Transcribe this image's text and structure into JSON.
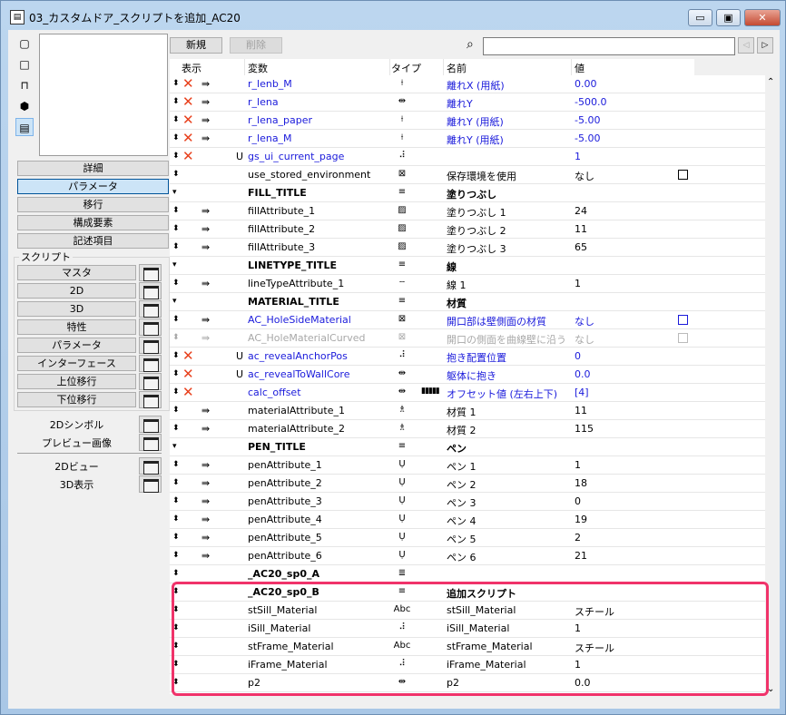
{
  "window": {
    "title": "03_カスタムドア_スクリプトを追加_AC20",
    "minimize": "▭",
    "restore": "▣",
    "close": "✕"
  },
  "left": {
    "panel_buttons": [
      {
        "label": "詳細"
      },
      {
        "label": "パラメータ",
        "selected": true
      },
      {
        "label": "移行"
      },
      {
        "label": "構成要素"
      },
      {
        "label": "記述項目"
      }
    ],
    "script_group_label": "スクリプト",
    "script_buttons": [
      "マスタ",
      "2D",
      "3D",
      "特性",
      "パラメータ",
      "インターフェース",
      "上位移行",
      "下位移行"
    ],
    "extra_items": [
      "2Dシンボル",
      "プレビュー画像"
    ],
    "view_items": [
      "2Dビュー",
      "3D表示"
    ]
  },
  "toolbar": {
    "new_label": "新規",
    "delete_label": "削除",
    "search_value": "",
    "prev": "◁",
    "next": "▷"
  },
  "columns": {
    "show": "表示",
    "variable": "変数",
    "type": "タイプ",
    "name": "名前",
    "value": "値"
  },
  "rows": [
    {
      "var": "r_lenb_M",
      "type": "⟊",
      "name": "離れX (用紙)",
      "value": "0.00",
      "x": true,
      "ind": true,
      "style": "blue"
    },
    {
      "var": "r_lena",
      "type": "⇹",
      "name": "離れY",
      "value": "-500.0",
      "x": true,
      "ind": true,
      "style": "blue"
    },
    {
      "var": "r_lena_paper",
      "type": "⟊",
      "name": "離れY (用紙)",
      "value": "-5.00",
      "x": true,
      "ind": true,
      "style": "blue"
    },
    {
      "var": "r_lena_M",
      "type": "⟊",
      "name": "離れY (用紙)",
      "value": "-5.00",
      "x": true,
      "ind": true,
      "style": "blue"
    },
    {
      "var": "gs_ui_current_page",
      "type": "⠼",
      "name": "",
      "value": "1",
      "x": true,
      "u": true,
      "style": "blue"
    },
    {
      "var": "use_stored_environment",
      "type": "⊠",
      "name": "保存環境を使用",
      "value": "なし",
      "cb": true
    },
    {
      "var": "FILL_TITLE",
      "type": "≡",
      "name": "塗りつぶし",
      "value": "",
      "style": "bold",
      "arrowDown": true
    },
    {
      "var": "fillAttribute_1",
      "type": "▨",
      "name": "塗りつぶし 1",
      "value": "24",
      "ind": true
    },
    {
      "var": "fillAttribute_2",
      "type": "▨",
      "name": "塗りつぶし 2",
      "value": "11",
      "ind": true
    },
    {
      "var": "fillAttribute_3",
      "type": "▨",
      "name": "塗りつぶし 3",
      "value": "65",
      "ind": true
    },
    {
      "var": "LINETYPE_TITLE",
      "type": "≡",
      "name": "線",
      "value": "",
      "style": "bold",
      "arrowDown": true
    },
    {
      "var": "lineTypeAttribute_1",
      "type": "┄",
      "name": "線 1",
      "value": "1",
      "ind": true
    },
    {
      "var": "MATERIAL_TITLE",
      "type": "≡",
      "name": "材質",
      "value": "",
      "style": "bold",
      "arrowDown": true
    },
    {
      "var": "AC_HoleSideMaterial",
      "type": "⊠",
      "name": "開口部は壁側面の材質",
      "value": "なし",
      "ind": true,
      "cb": true,
      "style": "blue"
    },
    {
      "var": "AC_HoleMaterialCurved",
      "type": "⊠",
      "name": "開口の側面を曲線壁に沿う",
      "value": "なし",
      "ind": true,
      "cb": true,
      "style": "gray"
    },
    {
      "var": "ac_revealAnchorPos",
      "type": "⠼",
      "name": "抱き配置位置",
      "value": "0",
      "x": true,
      "u": true,
      "style": "blue"
    },
    {
      "var": "ac_revealToWallCore",
      "type": "⇹",
      "name": "躯体に抱き",
      "value": "0.0",
      "x": true,
      "u": true,
      "style": "blue"
    },
    {
      "var": "calc_offset",
      "type": "⇹",
      "extra": "▮▮▮▮▮",
      "name": "オフセット値 (左右上下)",
      "value": "[4]",
      "x": true,
      "style": "blue"
    },
    {
      "var": "materialAttribute_1",
      "type": "♗",
      "name": "材質 1",
      "value": "11",
      "ind": true
    },
    {
      "var": "materialAttribute_2",
      "type": "♗",
      "name": "材質 2",
      "value": "115",
      "ind": true
    },
    {
      "var": "PEN_TITLE",
      "type": "≡",
      "name": "ペン",
      "value": "",
      "style": "bold",
      "arrowDown": true
    },
    {
      "var": "penAttribute_1",
      "type": "Ụ",
      "name": "ペン 1",
      "value": "1",
      "ind": true
    },
    {
      "var": "penAttribute_2",
      "type": "Ụ",
      "name": "ペン 2",
      "value": "18",
      "ind": true
    },
    {
      "var": "penAttribute_3",
      "type": "Ụ",
      "name": "ペン 3",
      "value": "0",
      "ind": true
    },
    {
      "var": "penAttribute_4",
      "type": "Ụ",
      "name": "ペン 4",
      "value": "19",
      "ind": true
    },
    {
      "var": "penAttribute_5",
      "type": "Ụ",
      "name": "ペン 5",
      "value": "2",
      "ind": true
    },
    {
      "var": "penAttribute_6",
      "type": "Ụ",
      "name": "ペン 6",
      "value": "21",
      "ind": true
    },
    {
      "var": "_AC20_sp0_A",
      "type": "≣",
      "name": "",
      "value": "",
      "style": "bold"
    },
    {
      "var": "_AC20_sp0_B",
      "type": "≡",
      "name": "追加スクリプト",
      "value": "",
      "style": "bold"
    },
    {
      "var": "stSill_Material",
      "type": "Abc",
      "name": "stSill_Material",
      "value": "スチール"
    },
    {
      "var": "iSill_Material",
      "type": "⠼",
      "name": "iSill_Material",
      "value": "1"
    },
    {
      "var": "stFrame_Material",
      "type": "Abc",
      "name": "stFrame_Material",
      "value": "スチール"
    },
    {
      "var": "iFrame_Material",
      "type": "⠼",
      "name": "iFrame_Material",
      "value": "1"
    },
    {
      "var": "p2",
      "type": "⇹",
      "name": "p2",
      "value": "0.0"
    }
  ],
  "colors": {
    "highlight": "#f0336a",
    "link": "#1a1adb",
    "delete_x": "#e8401c"
  }
}
